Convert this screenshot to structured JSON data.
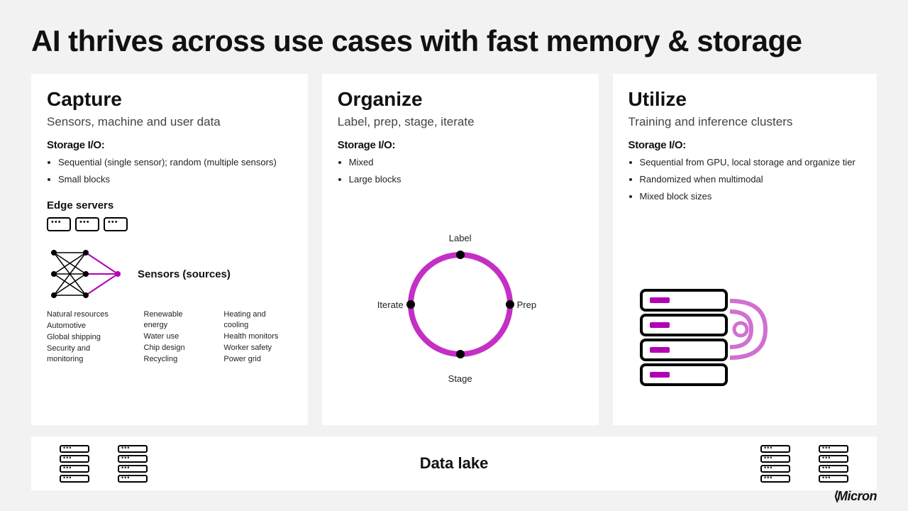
{
  "title": "AI thrives across use cases with fast memory & storage",
  "columns": {
    "capture": {
      "title": "Capture",
      "subtitle": "Sensors, machine and user data",
      "io_label": "Storage I/O:",
      "bullets": [
        "Sequential (single sensor); random (multiple sensors)",
        "Small blocks"
      ],
      "edge_label": "Edge servers",
      "sensors_label": "Sensors (sources)",
      "sources_col1": [
        "Natural resources",
        "Automotive",
        "Global shipping",
        "Security and monitoring"
      ],
      "sources_col2": [
        "Renewable energy",
        "Water use",
        "Chip design",
        "Recycling"
      ],
      "sources_col3": [
        "Heating and cooling",
        "Health monitors",
        "Worker safety",
        "Power grid"
      ]
    },
    "organize": {
      "title": "Organize",
      "subtitle": "Label, prep, stage, iterate",
      "io_label": "Storage I/O:",
      "bullets": [
        "Mixed",
        "Large blocks"
      ],
      "cycle": {
        "top": "Label",
        "right": "Prep",
        "bottom": "Stage",
        "left": "Iterate"
      }
    },
    "utilize": {
      "title": "Utilize",
      "subtitle": "Training and inference clusters",
      "io_label": "Storage I/O:",
      "bullets": [
        "Sequential from GPU, local storage and organize tier",
        "Randomized when multimodal",
        "Mixed block sizes"
      ]
    }
  },
  "datalake": {
    "label": "Data lake"
  },
  "brand": "Micron",
  "colors": {
    "accent": "#b300b3"
  }
}
